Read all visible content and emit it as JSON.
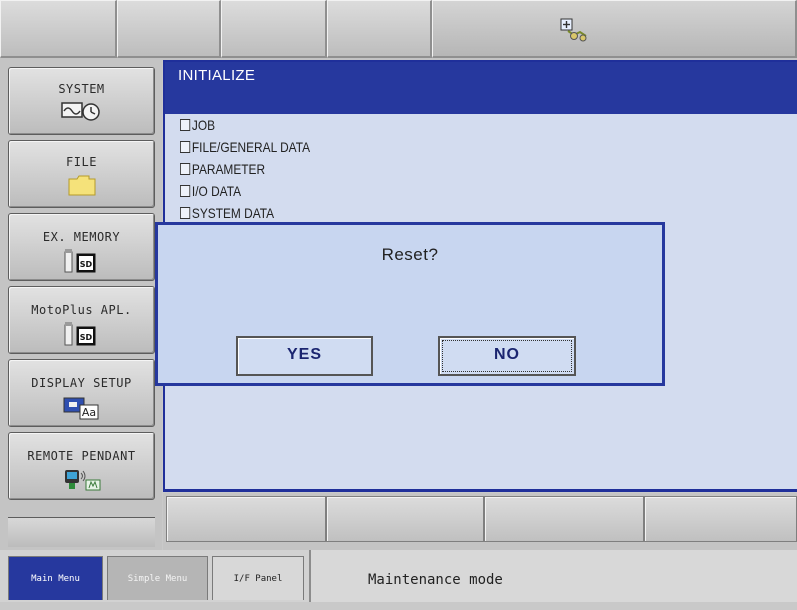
{
  "top_bar": {
    "status_icon": "robot-status-icon"
  },
  "left_menu": [
    {
      "label": "SYSTEM",
      "icon": "system-clock-icon"
    },
    {
      "label": "FILE",
      "icon": "folder-icon"
    },
    {
      "label": "EX. MEMORY",
      "icon": "sd-card-icon"
    },
    {
      "label": "MotoPlus APL.",
      "icon": "sd-card-icon"
    },
    {
      "label": "DISPLAY SETUP",
      "icon": "display-font-icon"
    },
    {
      "label": "REMOTE PENDANT",
      "icon": "remote-pendant-icon"
    }
  ],
  "main": {
    "title": "INITIALIZE",
    "items": [
      "JOB",
      "FILE/GENERAL DATA",
      "PARAMETER",
      "I/O DATA",
      "SYSTEM DATA"
    ]
  },
  "dialog": {
    "message": "Reset?",
    "yes_label": "YES",
    "no_label": "NO"
  },
  "status_bar": {
    "tabs": [
      "Main Menu",
      "Simple Menu",
      "I/F Panel"
    ],
    "mode": "Maintenance mode"
  },
  "colors": {
    "accent": "#26389e",
    "window_bg": "#d3dcef",
    "chrome": "#c4c4c4"
  }
}
